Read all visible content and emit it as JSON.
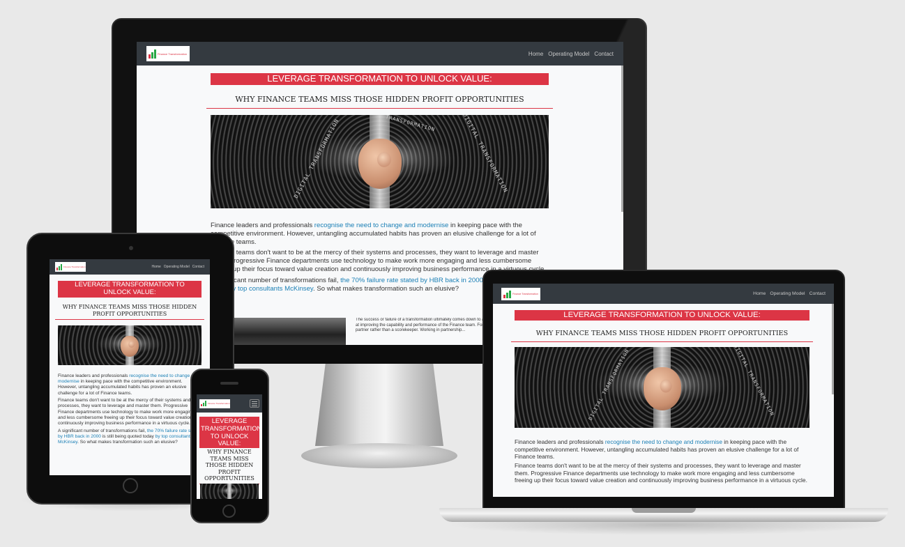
{
  "site": {
    "logo_text": "Finance Transformation",
    "nav": [
      "Home",
      "Operating Model",
      "Contact"
    ],
    "banner": "LEVERAGE TRANSFORMATION TO UNLOCK VALUE:",
    "subheading": "WHY FINANCE TEAMS MISS THOSE HIDDEN PROFIT OPPORTUNITIES",
    "hero_words": [
      "DIGITAL TRANSFORMATION",
      "DIGITAL TRANSFORMATION",
      "TRANSFORMATION"
    ],
    "p1_pre": "Finance leaders and professionals ",
    "p1_link": "recognise the need to change and modernise",
    "p1_post": " in keeping pace with the competitive environment. However, untangling accumulated habits has proven an elusive challenge for a lot of Finance teams.",
    "p2": "Finance teams don't want to be at the mercy of their systems and processes, they want to leverage and master them. Progressive Finance departments use technology to make work more engaging and less cumbersome freeing up their focus toward value creation and continuously improving business performance in a virtuous cycle.",
    "p3_pre": "A significant number of transformations fail, ",
    "p3_link1": "the 70% failure rate stated by HBR back in 2000",
    "p3_mid": " is still being quoted today ",
    "p3_link2": "by top consultants McKinsey",
    "p3_post": ". So what makes transformation such an elusive?",
    "p4": "The success or failure of a transformation ultimately comes down to a robust execution strategy targeted at improving the capability and performance of the Finance team. For Finance to be valued as a business partner rather than a scorekeeper. Working in partnership..."
  },
  "colors": {
    "accent_red": "#dc3545",
    "navbar": "#343a40",
    "link": "#1a7fb5",
    "page_bg": "#e9e9e9"
  }
}
